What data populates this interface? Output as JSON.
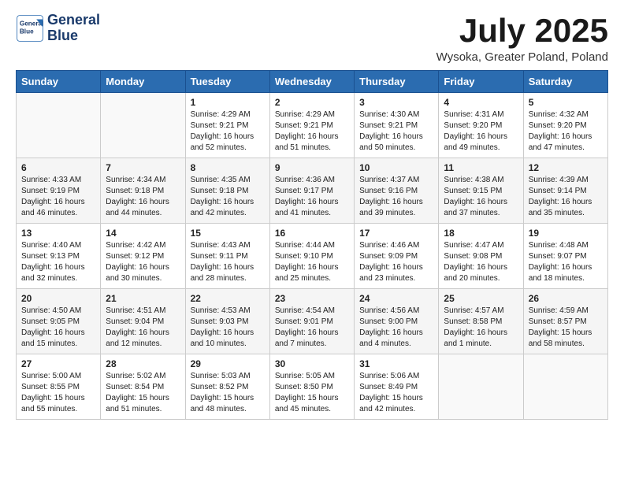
{
  "header": {
    "logo_line1": "General",
    "logo_line2": "Blue",
    "month_year": "July 2025",
    "location": "Wysoka, Greater Poland, Poland"
  },
  "weekdays": [
    "Sunday",
    "Monday",
    "Tuesday",
    "Wednesday",
    "Thursday",
    "Friday",
    "Saturday"
  ],
  "weeks": [
    [
      {
        "day": "",
        "info": ""
      },
      {
        "day": "",
        "info": ""
      },
      {
        "day": "1",
        "info": "Sunrise: 4:29 AM\nSunset: 9:21 PM\nDaylight: 16 hours and 52 minutes."
      },
      {
        "day": "2",
        "info": "Sunrise: 4:29 AM\nSunset: 9:21 PM\nDaylight: 16 hours and 51 minutes."
      },
      {
        "day": "3",
        "info": "Sunrise: 4:30 AM\nSunset: 9:21 PM\nDaylight: 16 hours and 50 minutes."
      },
      {
        "day": "4",
        "info": "Sunrise: 4:31 AM\nSunset: 9:20 PM\nDaylight: 16 hours and 49 minutes."
      },
      {
        "day": "5",
        "info": "Sunrise: 4:32 AM\nSunset: 9:20 PM\nDaylight: 16 hours and 47 minutes."
      }
    ],
    [
      {
        "day": "6",
        "info": "Sunrise: 4:33 AM\nSunset: 9:19 PM\nDaylight: 16 hours and 46 minutes."
      },
      {
        "day": "7",
        "info": "Sunrise: 4:34 AM\nSunset: 9:18 PM\nDaylight: 16 hours and 44 minutes."
      },
      {
        "day": "8",
        "info": "Sunrise: 4:35 AM\nSunset: 9:18 PM\nDaylight: 16 hours and 42 minutes."
      },
      {
        "day": "9",
        "info": "Sunrise: 4:36 AM\nSunset: 9:17 PM\nDaylight: 16 hours and 41 minutes."
      },
      {
        "day": "10",
        "info": "Sunrise: 4:37 AM\nSunset: 9:16 PM\nDaylight: 16 hours and 39 minutes."
      },
      {
        "day": "11",
        "info": "Sunrise: 4:38 AM\nSunset: 9:15 PM\nDaylight: 16 hours and 37 minutes."
      },
      {
        "day": "12",
        "info": "Sunrise: 4:39 AM\nSunset: 9:14 PM\nDaylight: 16 hours and 35 minutes."
      }
    ],
    [
      {
        "day": "13",
        "info": "Sunrise: 4:40 AM\nSunset: 9:13 PM\nDaylight: 16 hours and 32 minutes."
      },
      {
        "day": "14",
        "info": "Sunrise: 4:42 AM\nSunset: 9:12 PM\nDaylight: 16 hours and 30 minutes."
      },
      {
        "day": "15",
        "info": "Sunrise: 4:43 AM\nSunset: 9:11 PM\nDaylight: 16 hours and 28 minutes."
      },
      {
        "day": "16",
        "info": "Sunrise: 4:44 AM\nSunset: 9:10 PM\nDaylight: 16 hours and 25 minutes."
      },
      {
        "day": "17",
        "info": "Sunrise: 4:46 AM\nSunset: 9:09 PM\nDaylight: 16 hours and 23 minutes."
      },
      {
        "day": "18",
        "info": "Sunrise: 4:47 AM\nSunset: 9:08 PM\nDaylight: 16 hours and 20 minutes."
      },
      {
        "day": "19",
        "info": "Sunrise: 4:48 AM\nSunset: 9:07 PM\nDaylight: 16 hours and 18 minutes."
      }
    ],
    [
      {
        "day": "20",
        "info": "Sunrise: 4:50 AM\nSunset: 9:05 PM\nDaylight: 16 hours and 15 minutes."
      },
      {
        "day": "21",
        "info": "Sunrise: 4:51 AM\nSunset: 9:04 PM\nDaylight: 16 hours and 12 minutes."
      },
      {
        "day": "22",
        "info": "Sunrise: 4:53 AM\nSunset: 9:03 PM\nDaylight: 16 hours and 10 minutes."
      },
      {
        "day": "23",
        "info": "Sunrise: 4:54 AM\nSunset: 9:01 PM\nDaylight: 16 hours and 7 minutes."
      },
      {
        "day": "24",
        "info": "Sunrise: 4:56 AM\nSunset: 9:00 PM\nDaylight: 16 hours and 4 minutes."
      },
      {
        "day": "25",
        "info": "Sunrise: 4:57 AM\nSunset: 8:58 PM\nDaylight: 16 hours and 1 minute."
      },
      {
        "day": "26",
        "info": "Sunrise: 4:59 AM\nSunset: 8:57 PM\nDaylight: 15 hours and 58 minutes."
      }
    ],
    [
      {
        "day": "27",
        "info": "Sunrise: 5:00 AM\nSunset: 8:55 PM\nDaylight: 15 hours and 55 minutes."
      },
      {
        "day": "28",
        "info": "Sunrise: 5:02 AM\nSunset: 8:54 PM\nDaylight: 15 hours and 51 minutes."
      },
      {
        "day": "29",
        "info": "Sunrise: 5:03 AM\nSunset: 8:52 PM\nDaylight: 15 hours and 48 minutes."
      },
      {
        "day": "30",
        "info": "Sunrise: 5:05 AM\nSunset: 8:50 PM\nDaylight: 15 hours and 45 minutes."
      },
      {
        "day": "31",
        "info": "Sunrise: 5:06 AM\nSunset: 8:49 PM\nDaylight: 15 hours and 42 minutes."
      },
      {
        "day": "",
        "info": ""
      },
      {
        "day": "",
        "info": ""
      }
    ]
  ]
}
